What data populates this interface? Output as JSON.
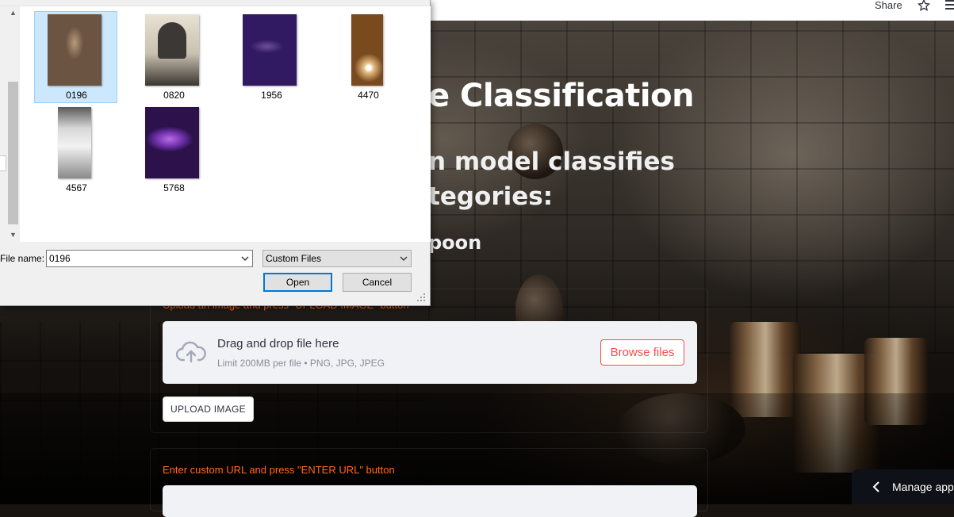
{
  "browser": {
    "share_label": "Share"
  },
  "app": {
    "title": "e Classification",
    "subtitle_line1": "n model classifies",
    "subtitle_line2": "tegories:",
    "category_partial": "poon",
    "upload_hint": "Upload an image and press \"UPLOAD IMAGE\" button",
    "dropzone": {
      "main_text": "Drag and drop file here",
      "sub_text": "Limit 200MB per file • PNG, JPG, JPEG",
      "browse_label": "Browse files"
    },
    "upload_button_label": "UPLOAD IMAGE",
    "url_hint": "Enter custom URL and press \"ENTER URL\" button",
    "manage_app_label": "Manage app"
  },
  "dialog": {
    "files": [
      {
        "name": "0196",
        "selected": true
      },
      {
        "name": "0820",
        "selected": false
      },
      {
        "name": "1956",
        "selected": false
      },
      {
        "name": "4470",
        "selected": false
      },
      {
        "name": "4567",
        "selected": false
      },
      {
        "name": "5768",
        "selected": false
      }
    ],
    "file_name_label": "File name:",
    "file_name_value": "0196",
    "file_type_value": "Custom Files",
    "open_label": "Open",
    "cancel_label": "Cancel"
  },
  "colors": {
    "accent": "#ff4b4b",
    "hint": "#ff6a1a",
    "selection": "#cce8ff"
  }
}
